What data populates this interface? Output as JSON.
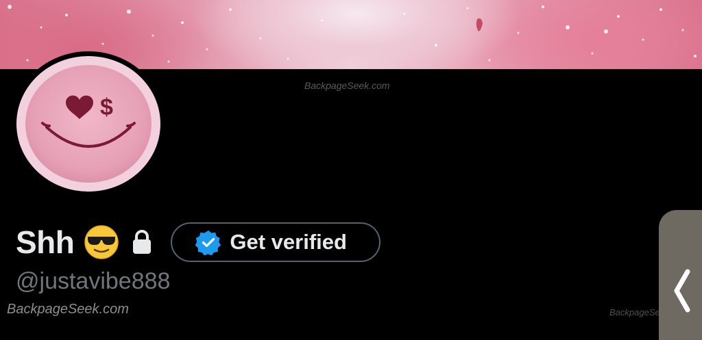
{
  "profile": {
    "display_name": "Shh",
    "handle": "@justavibe888",
    "name_emoji": "smiling-face-with-sunglasses",
    "protected_icon": "lock-icon",
    "avatar": {
      "type": "pink smiley face with heart and dollar-sign eyes",
      "heart_eye": "♥",
      "dollar_eye": "$"
    }
  },
  "verify_button": {
    "label": "Get verified",
    "icon": "verified-badge-icon"
  },
  "watermarks": {
    "top": "BackpageSeek.com",
    "bottom_left": "BackpageSeek.com",
    "bottom_right": "BackpageSeek.com"
  },
  "side_panel": {
    "icon": "chevron-left-icon"
  },
  "colors": {
    "background": "#000000",
    "name_text": "#e7e9ea",
    "handle_text": "#71767b",
    "button_border": "#536471",
    "verified_blue": "#1d9bf0",
    "avatar_pink": "#f3d0dd",
    "banner_pink": "#e49aaf"
  }
}
